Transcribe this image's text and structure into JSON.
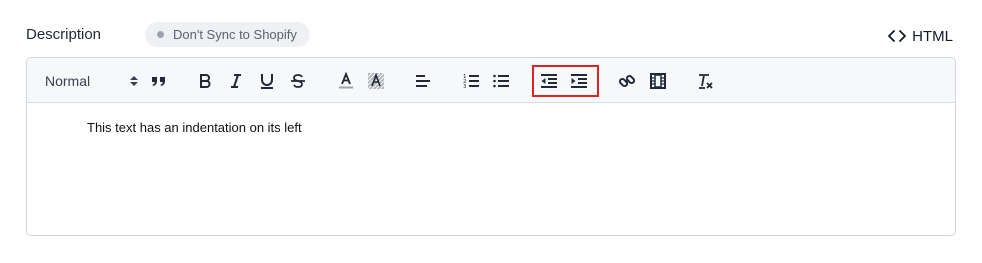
{
  "field": {
    "label": "Description",
    "sync_badge": "Don't Sync to Shopify",
    "html_toggle": "HTML"
  },
  "toolbar": {
    "format_select": "Normal",
    "buttons": [
      "blockquote",
      "bold",
      "italic",
      "underline",
      "strike",
      "font-color",
      "background-color",
      "align",
      "ordered-list",
      "bullet-list",
      "outdent",
      "indent",
      "link",
      "video",
      "clear-formatting"
    ]
  },
  "editor": {
    "content": "This text has an indentation on its left"
  },
  "colors": {
    "highlight_border": "#e02424",
    "toolbar_bg": "#f7f8fa",
    "badge_bg": "#eef0f3"
  }
}
